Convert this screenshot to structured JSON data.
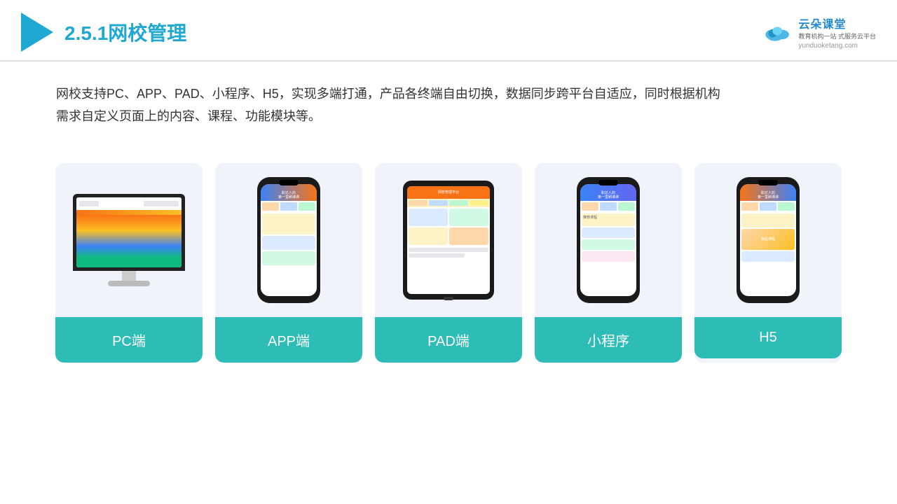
{
  "header": {
    "title_prefix": "2.5.1",
    "title_main": "网校管理",
    "brand": {
      "name": "云朵课堂",
      "url": "yunduoketang.com",
      "tagline_line1": "教育机构一站",
      "tagline_line2": "式服务云平台"
    }
  },
  "description": {
    "text": "网校支持PC、APP、PAD、小程序、H5，实现多端打通，产品各终端自由切换，数据同步跨平台自适应，同时根据机构",
    "text2": "需求自定义页面上的内容、课程、功能模块等。"
  },
  "cards": [
    {
      "id": "pc",
      "label": "PC端"
    },
    {
      "id": "app",
      "label": "APP端"
    },
    {
      "id": "pad",
      "label": "PAD端"
    },
    {
      "id": "miniapp",
      "label": "小程序"
    },
    {
      "id": "h5",
      "label": "H5"
    }
  ],
  "colors": {
    "teal": "#2dbcb6",
    "accent_blue": "#1fa8d1",
    "text_dark": "#333333"
  }
}
